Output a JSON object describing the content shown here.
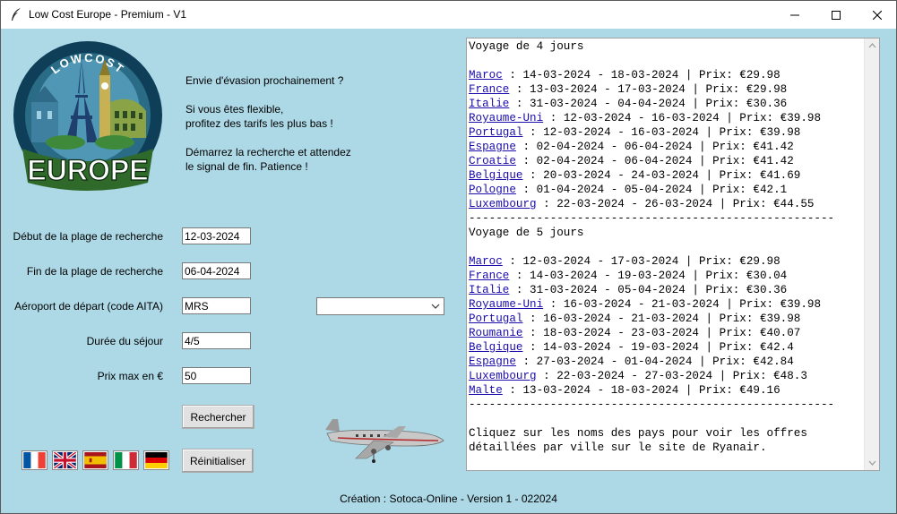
{
  "window": {
    "title": "Low Cost Europe - Premium - V1",
    "icon": "feather-icon"
  },
  "logo": {
    "top_text": "LOWCOST",
    "bottom_text": "EUROPE"
  },
  "intro": {
    "line1": "Envie d'évasion prochainement ?",
    "line2": "Si vous êtes flexible,",
    "line3": "profitez des tarifs les plus bas !",
    "line4": "Démarrez la recherche et attendez",
    "line5": "le signal de fin. Patience !"
  },
  "form": {
    "start_label": "Début de la plage de recherche",
    "start_value": "12-03-2024",
    "end_label": "Fin de la plage de recherche",
    "end_value": "06-04-2024",
    "airport_label": "Aéroport de départ (code AITA)",
    "airport_value": "MRS",
    "airport_combo_value": "",
    "duration_label": "Durée du séjour",
    "duration_value": "4/5",
    "price_label": "Prix max en €",
    "price_value": "50",
    "search_button": "Rechercher",
    "reset_button": "Réinitialiser"
  },
  "flags": [
    "france-flag",
    "uk-flag",
    "spain-flag",
    "italy-flag",
    "germany-flag"
  ],
  "footer": "Création : Sotoca-Online - Version 1 - 022024",
  "results": {
    "lines": [
      {
        "text": "Voyage de 4 jours"
      },
      {
        "text": ""
      },
      {
        "country": "Maroc",
        "text": " : 14-03-2024 - 18-03-2024 | Prix: €29.98"
      },
      {
        "country": "France",
        "text": " : 13-03-2024 - 17-03-2024 | Prix: €29.98"
      },
      {
        "country": "Italie",
        "text": " : 31-03-2024 - 04-04-2024 | Prix: €30.36"
      },
      {
        "country": "Royaume-Uni",
        "text": " : 12-03-2024 - 16-03-2024 | Prix: €39.98"
      },
      {
        "country": "Portugal",
        "text": " : 12-03-2024 - 16-03-2024 | Prix: €39.98"
      },
      {
        "country": "Espagne",
        "text": " : 02-04-2024 - 06-04-2024 | Prix: €41.42"
      },
      {
        "country": "Croatie",
        "text": " : 02-04-2024 - 06-04-2024 | Prix: €41.42"
      },
      {
        "country": "Belgique",
        "text": " : 20-03-2024 - 24-03-2024 | Prix: €41.69"
      },
      {
        "country": "Pologne",
        "text": " : 01-04-2024 - 05-04-2024 | Prix: €42.1"
      },
      {
        "country": "Luxembourg",
        "text": " : 22-03-2024 - 26-03-2024 | Prix: €44.55"
      },
      {
        "text": "------------------------------------------------------"
      },
      {
        "text": "Voyage de 5 jours"
      },
      {
        "text": ""
      },
      {
        "country": "Maroc",
        "text": " : 12-03-2024 - 17-03-2024 | Prix: €29.98"
      },
      {
        "country": "France",
        "text": " : 14-03-2024 - 19-03-2024 | Prix: €30.04"
      },
      {
        "country": "Italie",
        "text": " : 31-03-2024 - 05-04-2024 | Prix: €30.36"
      },
      {
        "country": "Royaume-Uni",
        "text": " : 16-03-2024 - 21-03-2024 | Prix: €39.98"
      },
      {
        "country": "Portugal",
        "text": " : 16-03-2024 - 21-03-2024 | Prix: €39.98"
      },
      {
        "country": "Roumanie",
        "text": " : 18-03-2024 - 23-03-2024 | Prix: €40.07"
      },
      {
        "country": "Belgique",
        "text": " : 14-03-2024 - 19-03-2024 | Prix: €42.4"
      },
      {
        "country": "Espagne",
        "text": " : 27-03-2024 - 01-04-2024 | Prix: €42.84"
      },
      {
        "country": "Luxembourg",
        "text": " : 22-03-2024 - 27-03-2024 | Prix: €48.3"
      },
      {
        "country": "Malte",
        "text": " : 13-03-2024 - 18-03-2024 | Prix: €49.16"
      },
      {
        "text": "------------------------------------------------------"
      },
      {
        "text": ""
      },
      {
        "text": "Cliquez sur les noms des pays pour voir les offres"
      },
      {
        "text": "détaillées par ville sur le site de Ryanair."
      }
    ]
  },
  "colors": {
    "background": "#add8e6",
    "link": "#1a0dab"
  }
}
